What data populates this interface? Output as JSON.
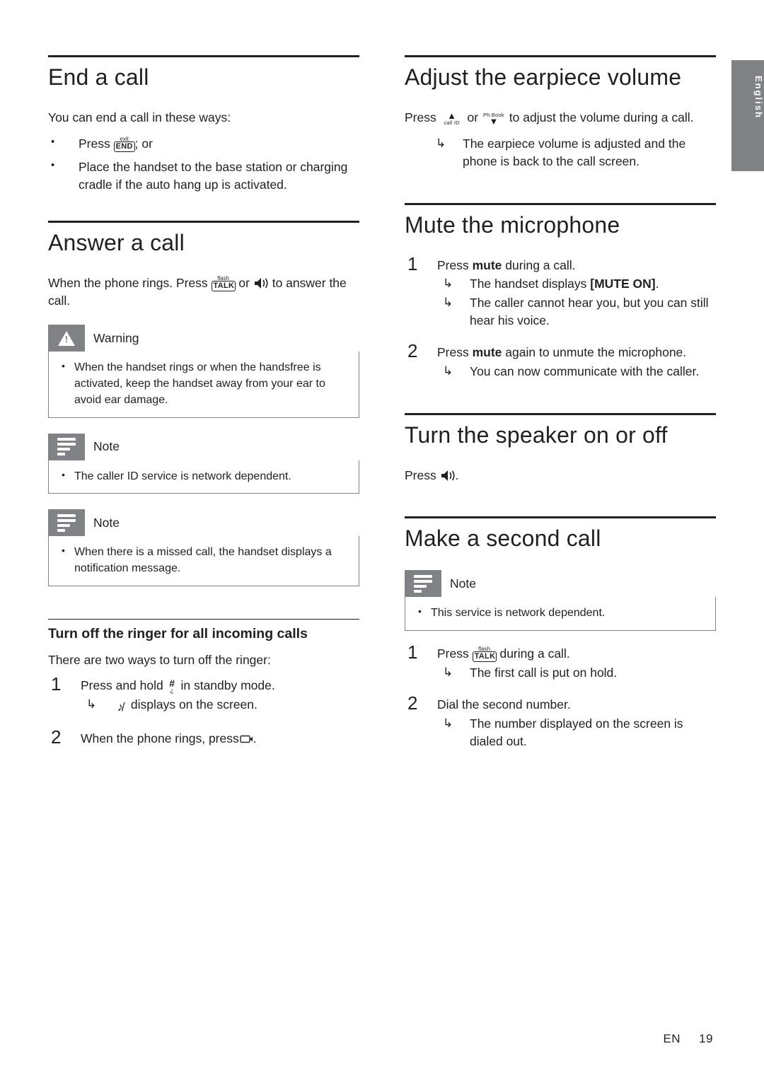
{
  "side_tab": {
    "label": "English"
  },
  "footer": {
    "lang": "EN",
    "page": "19"
  },
  "left_column": {
    "end_call": {
      "title": "End a call",
      "intro": "You can end a call in these ways:",
      "bullets": [
        {
          "pre": "Press ",
          "key": "END",
          "key_top": "exit",
          "post": "; or"
        },
        {
          "pre": "Place the handset to the base station or charging cradle if the auto hang up is activated.",
          "key": "",
          "key_top": "",
          "post": ""
        }
      ]
    },
    "answer_call": {
      "title": "Answer a call",
      "intro_pre": "When the phone rings. Press ",
      "intro_key1": "TALK",
      "intro_key1_top": "flash",
      "intro_mid": " or ",
      "intro_key2": "speaker-icon",
      "intro_post": " to answer the call."
    },
    "warning": {
      "label": "Warning",
      "items": [
        "When the handset rings or when the handsfree is activated, keep the handset away from your ear to avoid ear damage."
      ]
    },
    "note1": {
      "label": "Note",
      "items": [
        "The caller ID service is network dependent."
      ]
    },
    "note2": {
      "label": "Note",
      "items": [
        "When there is a missed call, the handset displays a notification message."
      ]
    },
    "ringer_off": {
      "title": "Turn off the ringer for all incoming calls",
      "intro": "There are two ways to turn off the ringer:",
      "steps": [
        {
          "num": "1",
          "pre": "Press and hold ",
          "key": "hash-key",
          "post": " in standby mode.",
          "arrows": [
            {
              "pre": "",
              "key": "mute-ringer-icon",
              "post": " displays on the screen."
            }
          ]
        },
        {
          "num": "2",
          "pre": "When the phone rings, press",
          "key": "end-key-small",
          "post": ".",
          "arrows": []
        }
      ]
    }
  },
  "right_column": {
    "earpiece_volume": {
      "title": "Adjust the earpiece volume",
      "intro_pre": "Press ",
      "key_up_glyph": "▲",
      "key_up_cap": "call ID",
      "intro_mid": " or ",
      "key_down_glyph": "▼",
      "key_down_cap": "Ph.Book",
      "intro_post": " to adjust the volume during a call.",
      "arrows": [
        {
          "text": "The earpiece volume is adjusted and the phone is back to the call screen."
        }
      ]
    },
    "mute_mic": {
      "title": "Mute the microphone",
      "steps": [
        {
          "num": "1",
          "pre": "Press ",
          "bold": "mute",
          "post": " during a call.",
          "arrows": [
            {
              "pre": "The handset displays ",
              "bold": "[MUTE ON]",
              "post": "."
            },
            {
              "pre": "The caller cannot hear you, but you can still hear his voice.",
              "bold": "",
              "post": ""
            }
          ]
        },
        {
          "num": "2",
          "pre": "Press ",
          "bold": "mute",
          "post": " again to unmute the microphone.",
          "arrows": [
            {
              "pre": "You can now communicate with the caller.",
              "bold": "",
              "post": ""
            }
          ]
        }
      ]
    },
    "speaker": {
      "title": "Turn the speaker on or off",
      "intro_pre": "Press ",
      "intro_key": "speaker-icon",
      "intro_post": "."
    },
    "second_call": {
      "title": "Make a second call",
      "note": {
        "label": "Note",
        "items": [
          "This service is network dependent."
        ]
      },
      "steps": [
        {
          "num": "1",
          "pre": "Press ",
          "key": "TALK",
          "key_top": "flash",
          "post": " during a call.",
          "arrows": [
            {
              "text": "The first call is put on hold."
            }
          ]
        },
        {
          "num": "2",
          "pre": "Dial the second number.",
          "key": "",
          "key_top": "",
          "post": "",
          "arrows": [
            {
              "text": "The number displayed on the screen is dialed out."
            }
          ]
        }
      ]
    }
  }
}
